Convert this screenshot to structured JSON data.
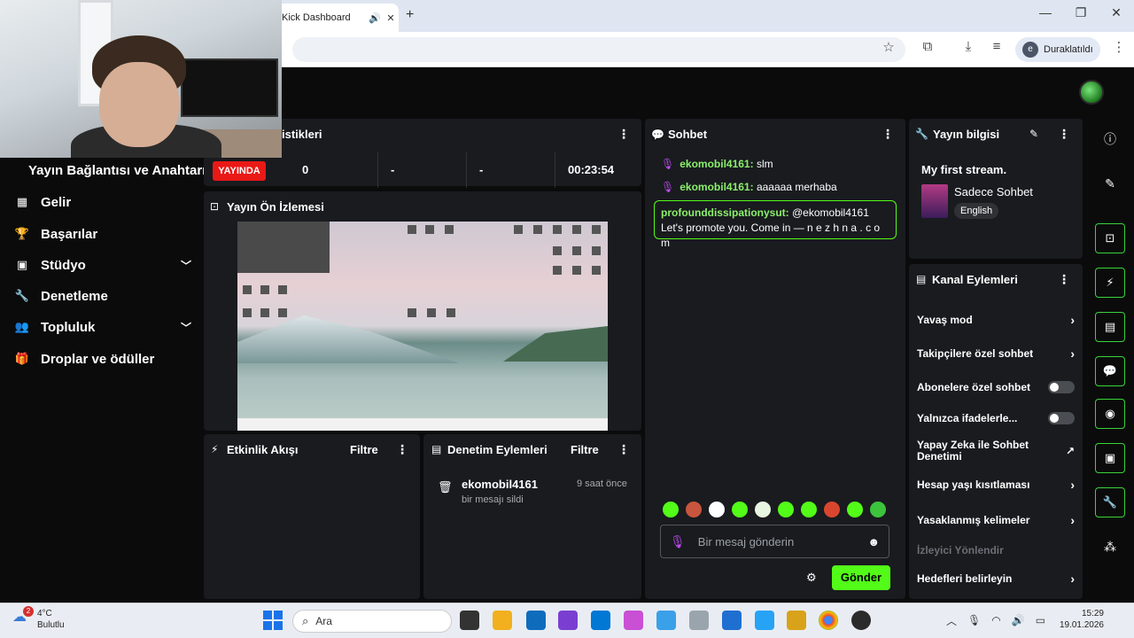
{
  "browser": {
    "tab_title": "Kick Dashboard",
    "new_tab": "+",
    "paused_label": "Duraklatıldı",
    "profile_initial": "e"
  },
  "sidebar": {
    "title": "Yayın Bağlantısı ve Anahtarı",
    "items": [
      {
        "label": "Gelir",
        "icon": "table-icon"
      },
      {
        "label": "Başarılar",
        "icon": "trophy-icon"
      },
      {
        "label": "Stüdyo",
        "icon": "studio-icon"
      },
      {
        "label": "Denetleme",
        "icon": "wrench-icon"
      },
      {
        "label": "Topluluk",
        "icon": "users-icon"
      },
      {
        "label": "Droplar ve ödüller",
        "icon": "gift-icon"
      }
    ]
  },
  "stats": {
    "title_partial": "istikleri",
    "live_badge": "YAYINDA",
    "viewers": "0",
    "stat2": "-",
    "stat3": "-",
    "duration": "00:23:54"
  },
  "preview": {
    "title": "Yayın Ön İzlemesi"
  },
  "events": {
    "title": "Etkinlik Akışı",
    "filter": "Filtre"
  },
  "modlog": {
    "title": "Denetim Eylemleri",
    "filter": "Filtre",
    "entry_user": "ekomobil4161",
    "entry_time": "9 saat önce",
    "entry_desc": "bir mesajı sildi"
  },
  "chat": {
    "title": "Sohbet",
    "messages": [
      {
        "user": "ekomobil4161:",
        "text": " slm"
      },
      {
        "user": "ekomobil4161:",
        "text": " aaaaaa merhaba"
      }
    ],
    "highlight": {
      "user": "profounddissipationysut:",
      "text": " @ekomobil4161 Let's promote you. Come in — n e z h n a . c o m"
    },
    "input_placeholder": "Bir mesaj gönderin",
    "send_label": "Gönder"
  },
  "info": {
    "title": "Yayın bilgisi",
    "stream_title": "My first stream.",
    "category": "Sadece Sohbet",
    "language": "English"
  },
  "actions": {
    "title": "Kanal Eylemleri",
    "items": [
      {
        "label": "Yavaş mod",
        "control": "chevron"
      },
      {
        "label": "Takipçilere özel sohbet",
        "control": "chevron"
      },
      {
        "label": "Abonelere özel sohbet",
        "control": "toggle"
      },
      {
        "label": "Yalnızca ifadelerle...",
        "control": "toggle"
      },
      {
        "label": "Yapay Zeka ile Sohbet Denetimi",
        "control": "external"
      },
      {
        "label": "Hesap yaşı kısıtlaması",
        "control": "chevron"
      },
      {
        "label": "Yasaklanmış kelimeler",
        "control": "chevron"
      },
      {
        "label": "İzleyici Yönlendir",
        "control": "none"
      },
      {
        "label": "Hedefleri belirleyin",
        "control": "chevron"
      }
    ]
  },
  "taskbar": {
    "weather_temp": "4°C",
    "weather_desc": "Bulutlu",
    "weather_badge": "2",
    "search_placeholder": "Ara",
    "time": "15:29",
    "date": "19.01.2026"
  },
  "colors": {
    "accent": "#53fc18",
    "live": "#e91916",
    "panel": "#191b1f",
    "mic": "#c04cf5"
  }
}
